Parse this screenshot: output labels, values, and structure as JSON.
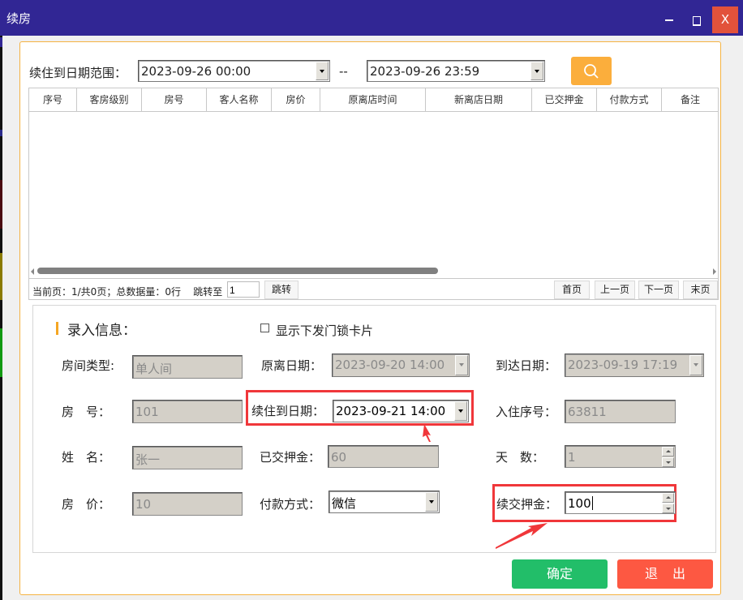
{
  "window": {
    "title": "续房",
    "controls": {
      "minimize": "",
      "maximize": "",
      "close": "X"
    }
  },
  "colors": {
    "titlebar": "#312694",
    "close": "#e2523b",
    "accent": "#fbae3c",
    "confirm": "#22be69",
    "exit": "#fd5842",
    "highlight": "#f0373a"
  },
  "filter": {
    "label": "续住到日期范围：",
    "start": "2023-09-26 00:00",
    "separator": "--",
    "end": "2023-09-26 23:59",
    "search_icon": "search-icon"
  },
  "grid": {
    "columns": [
      "序号",
      "客房级别",
      "房号",
      "客人名称",
      "房价",
      "原离店时间",
      "新离店日期",
      "已交押金",
      "付款方式",
      "备注"
    ],
    "rows": []
  },
  "pager": {
    "info": "当前页：1/共0页；总数据量：0行",
    "goto_label": "跳转至",
    "goto_value": "1",
    "goto_button": "跳转",
    "first": "首页",
    "prev": "上一页",
    "next": "下一页",
    "last": "末页"
  },
  "entry": {
    "section_title": "录入信息：",
    "show_card_label": "显示下发门锁卡片",
    "show_card_checked": false,
    "room_type_label": "房间类型:",
    "room_type": "单人间",
    "orig_leave_label": "原离日期：",
    "orig_leave": "2023-09-20 14:00",
    "arrive_label": "到达日期：",
    "arrive": "2023-09-19 17:19",
    "room_no_label": "房　号：",
    "room_no": "101",
    "extend_to_label": "续住到日期：",
    "extend_to": "2023-09-21 14:00",
    "checkin_no_label": "入住序号：",
    "checkin_no": "63811",
    "name_label": "姓　名：",
    "name": "张一",
    "paid_deposit_label": "已交押金：",
    "paid_deposit": "60",
    "days_label": "天　数：",
    "days": "1",
    "price_label": "房　价：",
    "price": "10",
    "payment_label": "付款方式：",
    "payment": "微信",
    "extra_deposit_label": "续交押金：",
    "extra_deposit": "100"
  },
  "actions": {
    "confirm": "确定",
    "exit": "退出"
  }
}
